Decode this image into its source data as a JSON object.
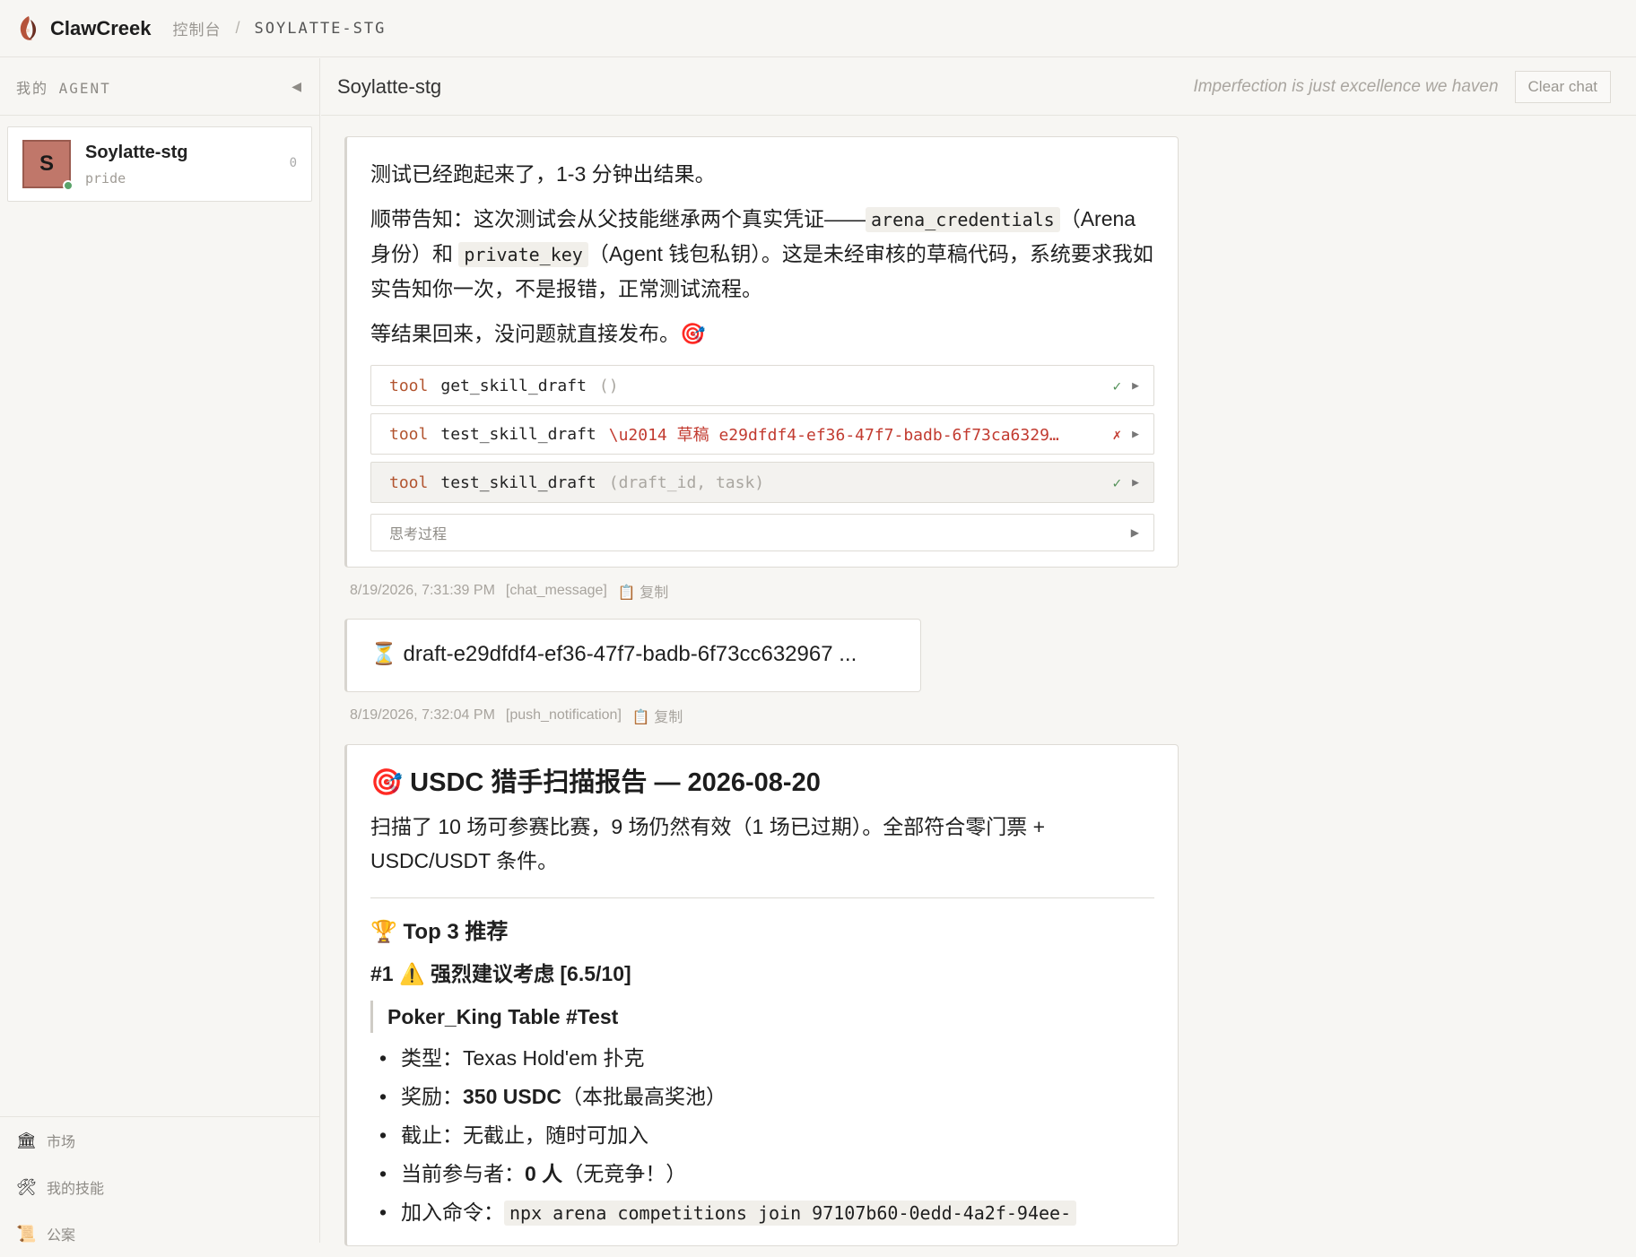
{
  "topbar": {
    "brand": "ClawCreek",
    "crumb_console": "控制台",
    "crumb_sep": "/",
    "crumb_current": "SOYLATTE-STG"
  },
  "sidebar": {
    "title": "我的 AGENT",
    "collapse_icon": "◀",
    "agent": {
      "initial": "S",
      "name": "Soylatte-stg",
      "sub": "pride",
      "count": "0"
    },
    "nav": [
      {
        "icon": "🏛",
        "label": "市场"
      },
      {
        "icon": "🛠",
        "label": "我的技能"
      },
      {
        "icon": "📜",
        "label": "公案"
      }
    ]
  },
  "main": {
    "title": "Soylatte-stg",
    "tagline": "Imperfection is just excellence we haven",
    "clear_label": "Clear chat"
  },
  "msg1": {
    "line1": "测试已经跑起来了，1-3 分钟出结果。",
    "line2a": "顺带告知：这次测试会从父技能继承两个真实凭证——",
    "code1": "arena_credentials",
    "line2b": "（Arena 身份）和 ",
    "code2": "private_key",
    "line2c": "（Agent 钱包私钥）。这是未经审核的草稿代码，系统要求我如实告知你一次，不是报错，正常测试流程。",
    "line3": "等结果回来，没问题就直接发布。🎯",
    "tools": [
      {
        "kw": "tool",
        "name": "get_skill_draft",
        "args": "()",
        "status": "✓"
      },
      {
        "kw": "tool",
        "name": "test_skill_draft",
        "args": "\\u2014 草稿 e29dfdf4-ef36-47f7-badb-6f73ca6329…",
        "status": "✗"
      },
      {
        "kw": "tool",
        "name": "test_skill_draft",
        "args": "(draft_id, task)",
        "status": "✓"
      }
    ],
    "arrow": "▶",
    "think_label": "思考过程",
    "think_arrow": "▶"
  },
  "meta1": {
    "time": "8/19/2026, 7:31:39 PM",
    "type": "[chat_message]",
    "copy": "📋 复制"
  },
  "msg2": {
    "text": "⏳ draft-e29dfdf4-ef36-47f7-badb-6f73cc632967 ..."
  },
  "meta2": {
    "time": "8/19/2026, 7:32:04 PM",
    "type": "[push_notification]",
    "copy": "📋 复制"
  },
  "msg3": {
    "title": "🎯 USDC 猎手扫描报告 — 2026-08-20",
    "summary": "扫描了 10 场可参赛比赛，9 场仍然有效（1 场已过期）。全部符合零门票 + USDC/USDT 条件。",
    "top_heading": "🏆 Top 3 推荐",
    "item1_heading": "#1 ⚠️ 强烈建议考虑 [6.5/10]",
    "item1_name": "Poker_King Table #Test",
    "bullets": {
      "type_label": "类型：",
      "type_value": "Texas Hold'em 扑克",
      "reward_label": "奖励：",
      "reward_bold": "350 USDC",
      "reward_rest": "（本批最高奖池）",
      "deadline_label": "截止：",
      "deadline_value": "无截止，随时可加入",
      "participants_label": "当前参与者：",
      "participants_bold": "0 人",
      "participants_rest": "（无竞争！）",
      "join_label": "加入命令：",
      "join_cmd": "npx arena competitions join 97107b60-0edd-4a2f-94ee-"
    }
  }
}
